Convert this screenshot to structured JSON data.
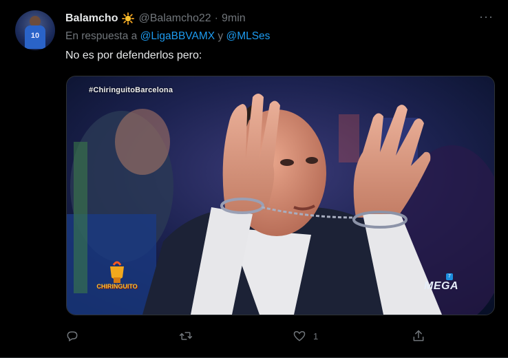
{
  "tweet": {
    "display_name": "Balamcho",
    "name_emoji": "sun-emoji",
    "handle": "@Balamcho22",
    "separator": "·",
    "timestamp": "9min",
    "reply_prefix": "En respuesta a",
    "reply_to_1": "@LigaBBVAMX",
    "reply_conjunction": "y",
    "reply_to_2": "@MLSes",
    "text": "No es por defenderlos pero:",
    "avatar_number": "10"
  },
  "media": {
    "hashtag_overlay": "#ChiringuitoBarcelona",
    "channel_logo": "MEGA",
    "show_logo": "CHIRINGUITO"
  },
  "actions": {
    "reply_icon": "reply-icon",
    "retweet_icon": "retweet-icon",
    "like_icon": "heart-icon",
    "like_count": "1",
    "share_icon": "share-icon"
  },
  "colors": {
    "background": "#000000",
    "text_primary": "#e7e9ea",
    "text_secondary": "#71767b",
    "link": "#1d9bf0"
  }
}
